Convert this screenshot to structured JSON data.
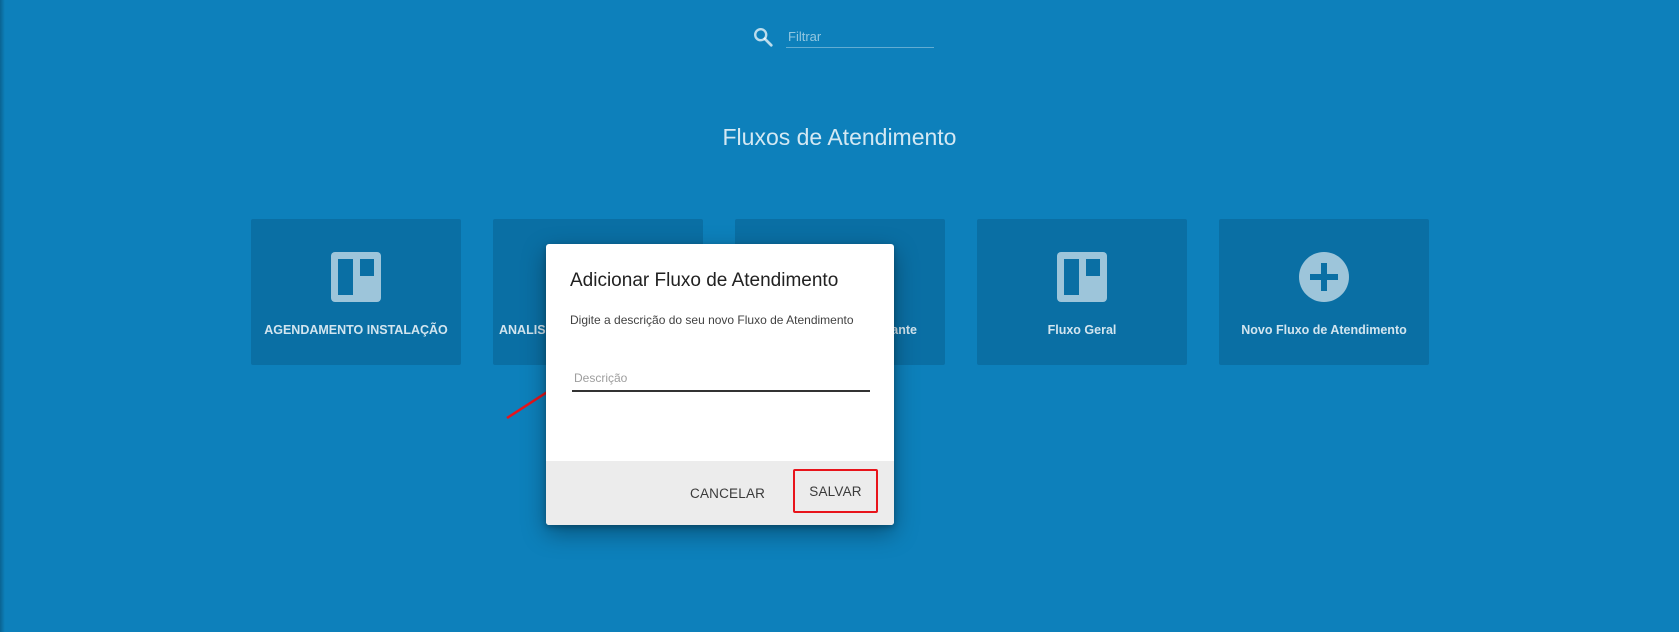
{
  "filter": {
    "placeholder": "Filtrar",
    "icon": "search-icon"
  },
  "page": {
    "title": "Fluxos de Atendimento"
  },
  "cards": [
    {
      "label": "AGENDAMENTO INSTALAÇÃO",
      "icon": "board-icon"
    },
    {
      "label": "ANALISE",
      "icon": "board-icon"
    },
    {
      "label": "ante",
      "icon": "board-icon"
    },
    {
      "label": "Fluxo Geral",
      "icon": "board-icon"
    },
    {
      "label": "Novo Fluxo de Atendimento",
      "icon": "add-circle-icon"
    }
  ],
  "dialog": {
    "title": "Adicionar Fluxo de Atendimento",
    "subtitle": "Digite a descrição do seu novo Fluxo de Atendimento",
    "description_placeholder": "Descrição",
    "description_value": "",
    "cancel_label": "CANCELAR",
    "save_label": "SALVAR"
  },
  "colors": {
    "background": "#0d80bb",
    "card": "#0a6fa4",
    "highlight": "#e8141b",
    "annotation_arrow": "#e8141b"
  }
}
